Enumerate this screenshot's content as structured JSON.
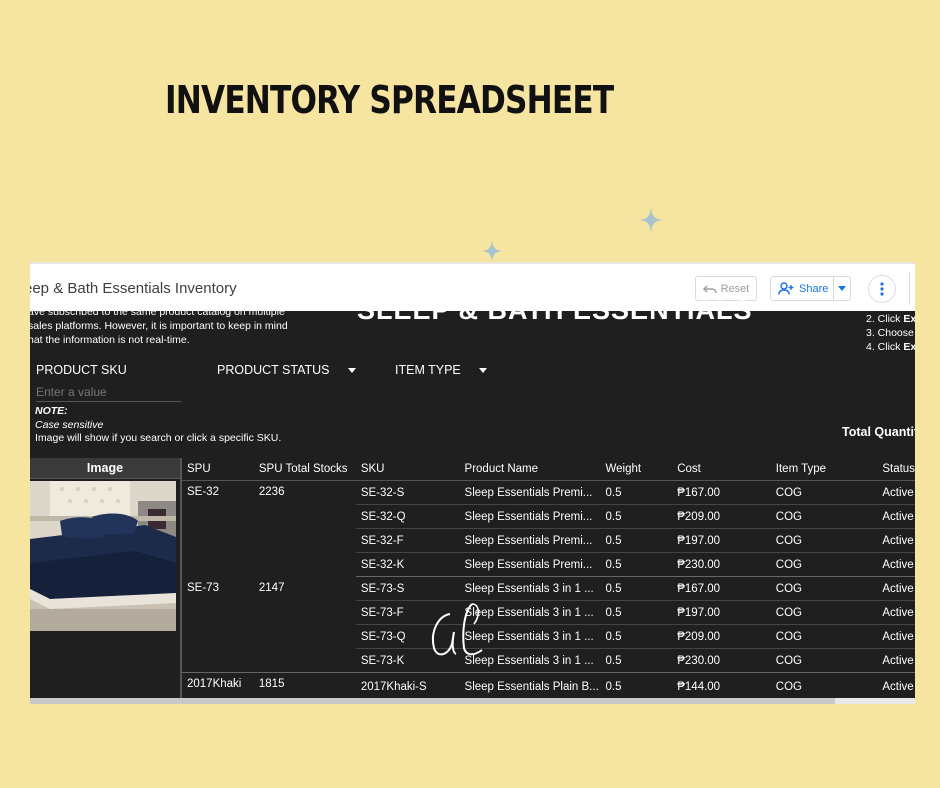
{
  "page": {
    "title": "INVENTORY SPREADSHEET",
    "background": "#f6e4a1"
  },
  "app": {
    "doc_title": "eep & Bath Essentials Inventory",
    "reset_label": "Reset",
    "share_label": "Share",
    "icons": [
      "undo-icon",
      "add-person-icon",
      "caret-down-icon",
      "more-vert-icon"
    ],
    "accent": "#1a73e8"
  },
  "dashboard": {
    "intro_lines": [
      "ave subscribed to the same product catalog on multiple",
      "sales platforms. However, it is important to keep in mind",
      "hat the information is not real-time."
    ],
    "banner": "SLEEP & BATH ESSENTIALS",
    "steps": [
      {
        "prefix": "2. Click ",
        "bold": "Ex"
      },
      {
        "prefix": "3. Choose",
        "bold": ""
      },
      {
        "prefix": "4. Click ",
        "bold": "Ex"
      }
    ],
    "filters": {
      "sku_label": "PRODUCT SKU",
      "sku_placeholder": "Enter a value",
      "status_label": "PRODUCT STATUS",
      "type_label": "ITEM TYPE"
    },
    "note": {
      "title": "NOTE:",
      "line1": "Case sensitive",
      "line2": "Image will show if you search or click a specific SKU."
    },
    "total_label": "Total Quantit",
    "image_header": "Image"
  },
  "table": {
    "columns": [
      "SPU",
      "SPU Total Stocks",
      "SKU",
      "Product Name",
      "Weight",
      "Cost",
      "Item Type",
      "Status"
    ],
    "groups": [
      {
        "spu": "SE-32",
        "total": "2236",
        "rows": [
          {
            "sku": "SE-32-S",
            "name": "Sleep Essentials Premi...",
            "weight": "0.5",
            "cost": "₱167.00",
            "type": "COG",
            "status": "Active"
          },
          {
            "sku": "SE-32-Q",
            "name": "Sleep Essentials Premi...",
            "weight": "0.5",
            "cost": "₱209.00",
            "type": "COG",
            "status": "Active"
          },
          {
            "sku": "SE-32-F",
            "name": "Sleep Essentials Premi...",
            "weight": "0.5",
            "cost": "₱197.00",
            "type": "COG",
            "status": "Active"
          },
          {
            "sku": "SE-32-K",
            "name": "Sleep Essentials Premi...",
            "weight": "0.5",
            "cost": "₱230.00",
            "type": "COG",
            "status": "Active"
          }
        ]
      },
      {
        "spu": "SE-73",
        "total": "2147",
        "rows": [
          {
            "sku": "SE-73-S",
            "name": "Sleep Essentials 3 in 1 ...",
            "weight": "0.5",
            "cost": "₱167.00",
            "type": "COG",
            "status": "Active"
          },
          {
            "sku": "SE-73-F",
            "name": "Sleep Essentials 3 in 1 ...",
            "weight": "0.5",
            "cost": "₱197.00",
            "type": "COG",
            "status": "Active"
          },
          {
            "sku": "SE-73-Q",
            "name": "Sleep Essentials 3 in 1 ...",
            "weight": "0.5",
            "cost": "₱209.00",
            "type": "COG",
            "status": "Active"
          },
          {
            "sku": "SE-73-K",
            "name": "Sleep Essentials 3 in 1 ...",
            "weight": "0.5",
            "cost": "₱230.00",
            "type": "COG",
            "status": "Active"
          }
        ]
      },
      {
        "spu": "2017Khaki",
        "total": "1815",
        "rows": [
          {
            "sku": "2017Khaki-S",
            "name": "Sleep Essentials Plain B...",
            "weight": "0.5",
            "cost": "₱144.00",
            "type": "COG",
            "status": "Active"
          }
        ]
      }
    ]
  },
  "watermark": "GL"
}
